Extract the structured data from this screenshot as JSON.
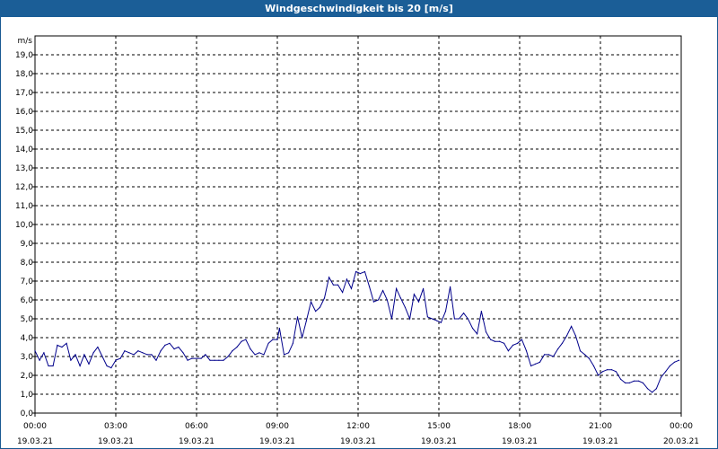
{
  "window": {
    "title": "Windgeschwindigkeit bis 20 [m/s]"
  },
  "colors": {
    "title_bar": "#1b5e97",
    "series": "#00008b",
    "grid": "#000000",
    "background": "#ffffff"
  },
  "chart_data": {
    "type": "line",
    "title": "Windgeschwindigkeit bis 20 [m/s]",
    "ylabel": "m/s",
    "xlabel": "",
    "ylim": [
      0,
      20
    ],
    "xlim": [
      0,
      24
    ],
    "grid": true,
    "grid_style": "dashed",
    "yticks": [
      {
        "value": 0,
        "label": "0,0"
      },
      {
        "value": 1,
        "label": "1,0"
      },
      {
        "value": 2,
        "label": "2,0"
      },
      {
        "value": 3,
        "label": "3,0"
      },
      {
        "value": 4,
        "label": "4,0"
      },
      {
        "value": 5,
        "label": "5,0"
      },
      {
        "value": 6,
        "label": "6,0"
      },
      {
        "value": 7,
        "label": "7,0"
      },
      {
        "value": 8,
        "label": "8,0"
      },
      {
        "value": 9,
        "label": "9,0"
      },
      {
        "value": 10,
        "label": "10,0"
      },
      {
        "value": 11,
        "label": "11,0"
      },
      {
        "value": 12,
        "label": "12,0"
      },
      {
        "value": 13,
        "label": "13,0"
      },
      {
        "value": 14,
        "label": "14,0"
      },
      {
        "value": 15,
        "label": "15,0"
      },
      {
        "value": 16,
        "label": "16,0"
      },
      {
        "value": 17,
        "label": "17,0"
      },
      {
        "value": 18,
        "label": "18,0"
      },
      {
        "value": 19,
        "label": "19,0"
      }
    ],
    "xticks": [
      {
        "value": 0,
        "time": "00:00",
        "date": "19.03.21"
      },
      {
        "value": 3,
        "time": "03:00",
        "date": "19.03.21"
      },
      {
        "value": 6,
        "time": "06:00",
        "date": "19.03.21"
      },
      {
        "value": 9,
        "time": "09:00",
        "date": "19.03.21"
      },
      {
        "value": 12,
        "time": "12:00",
        "date": "19.03.21"
      },
      {
        "value": 15,
        "time": "15:00",
        "date": "19.03.21"
      },
      {
        "value": 18,
        "time": "18:00",
        "date": "19.03.21"
      },
      {
        "value": 21,
        "time": "21:00",
        "date": "19.03.21"
      },
      {
        "value": 24,
        "time": "00:00",
        "date": "20.03.21"
      }
    ],
    "series": [
      {
        "points": [
          [
            0.0,
            3.3
          ],
          [
            0.17,
            2.8
          ],
          [
            0.33,
            3.2
          ],
          [
            0.5,
            2.5
          ],
          [
            0.67,
            2.5
          ],
          [
            0.83,
            3.6
          ],
          [
            1.0,
            3.5
          ],
          [
            1.17,
            3.7
          ],
          [
            1.33,
            2.8
          ],
          [
            1.5,
            3.1
          ],
          [
            1.67,
            2.5
          ],
          [
            1.83,
            3.1
          ],
          [
            2.0,
            2.6
          ],
          [
            2.17,
            3.2
          ],
          [
            2.33,
            3.5
          ],
          [
            2.5,
            3.0
          ],
          [
            2.67,
            2.5
          ],
          [
            2.83,
            2.4
          ],
          [
            3.0,
            2.8
          ],
          [
            3.17,
            2.9
          ],
          [
            3.33,
            3.3
          ],
          [
            3.5,
            3.2
          ],
          [
            3.67,
            3.1
          ],
          [
            3.83,
            3.3
          ],
          [
            4.0,
            3.2
          ],
          [
            4.17,
            3.1
          ],
          [
            4.33,
            3.1
          ],
          [
            4.5,
            2.8
          ],
          [
            4.67,
            3.3
          ],
          [
            4.83,
            3.6
          ],
          [
            5.0,
            3.7
          ],
          [
            5.17,
            3.4
          ],
          [
            5.33,
            3.5
          ],
          [
            5.5,
            3.2
          ],
          [
            5.67,
            2.8
          ],
          [
            5.83,
            2.9
          ],
          [
            6.0,
            2.9
          ],
          [
            6.17,
            2.9
          ],
          [
            6.33,
            3.1
          ],
          [
            6.5,
            2.8
          ],
          [
            6.67,
            2.8
          ],
          [
            6.83,
            2.8
          ],
          [
            7.0,
            2.8
          ],
          [
            7.17,
            3.0
          ],
          [
            7.33,
            3.3
          ],
          [
            7.5,
            3.5
          ],
          [
            7.67,
            3.8
          ],
          [
            7.83,
            3.9
          ],
          [
            8.0,
            3.4
          ],
          [
            8.17,
            3.1
          ],
          [
            8.33,
            3.2
          ],
          [
            8.5,
            3.1
          ],
          [
            8.67,
            3.7
          ],
          [
            8.83,
            3.9
          ],
          [
            9.0,
            3.9
          ],
          [
            9.08,
            4.5
          ],
          [
            9.25,
            3.1
          ],
          [
            9.42,
            3.2
          ],
          [
            9.58,
            3.7
          ],
          [
            9.75,
            5.1
          ],
          [
            9.92,
            4.0
          ],
          [
            10.08,
            4.9
          ],
          [
            10.25,
            5.9
          ],
          [
            10.42,
            5.4
          ],
          [
            10.58,
            5.6
          ],
          [
            10.75,
            6.1
          ],
          [
            10.92,
            7.2
          ],
          [
            11.08,
            6.8
          ],
          [
            11.25,
            6.8
          ],
          [
            11.42,
            6.4
          ],
          [
            11.58,
            7.1
          ],
          [
            11.75,
            6.6
          ],
          [
            11.92,
            7.5
          ],
          [
            12.08,
            7.4
          ],
          [
            12.25,
            7.5
          ],
          [
            12.42,
            6.7
          ],
          [
            12.58,
            5.9
          ],
          [
            12.75,
            6.0
          ],
          [
            12.92,
            6.5
          ],
          [
            13.08,
            6.0
          ],
          [
            13.25,
            5.0
          ],
          [
            13.42,
            6.6
          ],
          [
            13.58,
            6.1
          ],
          [
            13.75,
            5.6
          ],
          [
            13.92,
            5.0
          ],
          [
            14.08,
            6.3
          ],
          [
            14.25,
            5.9
          ],
          [
            14.42,
            6.6
          ],
          [
            14.58,
            5.1
          ],
          [
            14.75,
            5.0
          ],
          [
            14.92,
            4.9
          ],
          [
            15.08,
            4.8
          ],
          [
            15.25,
            5.4
          ],
          [
            15.42,
            6.7
          ],
          [
            15.58,
            5.0
          ],
          [
            15.75,
            5.0
          ],
          [
            15.92,
            5.3
          ],
          [
            16.08,
            5.0
          ],
          [
            16.25,
            4.5
          ],
          [
            16.42,
            4.2
          ],
          [
            16.58,
            5.4
          ],
          [
            16.75,
            4.3
          ],
          [
            16.92,
            3.9
          ],
          [
            17.08,
            3.8
          ],
          [
            17.25,
            3.8
          ],
          [
            17.42,
            3.7
          ],
          [
            17.58,
            3.3
          ],
          [
            17.75,
            3.6
          ],
          [
            17.92,
            3.7
          ],
          [
            18.08,
            3.9
          ],
          [
            18.25,
            3.3
          ],
          [
            18.42,
            2.5
          ],
          [
            18.58,
            2.6
          ],
          [
            18.75,
            2.7
          ],
          [
            18.92,
            3.1
          ],
          [
            19.08,
            3.1
          ],
          [
            19.25,
            3.0
          ],
          [
            19.42,
            3.4
          ],
          [
            19.58,
            3.7
          ],
          [
            19.75,
            4.1
          ],
          [
            19.92,
            4.6
          ],
          [
            20.08,
            4.1
          ],
          [
            20.25,
            3.3
          ],
          [
            20.42,
            3.1
          ],
          [
            20.58,
            2.9
          ],
          [
            20.75,
            2.5
          ],
          [
            20.92,
            2.0
          ],
          [
            21.08,
            2.2
          ],
          [
            21.25,
            2.3
          ],
          [
            21.42,
            2.3
          ],
          [
            21.58,
            2.2
          ],
          [
            21.75,
            1.8
          ],
          [
            21.92,
            1.6
          ],
          [
            22.08,
            1.6
          ],
          [
            22.25,
            1.7
          ],
          [
            22.42,
            1.7
          ],
          [
            22.58,
            1.6
          ],
          [
            22.75,
            1.3
          ],
          [
            22.92,
            1.1
          ],
          [
            23.08,
            1.3
          ],
          [
            23.25,
            1.9
          ],
          [
            23.42,
            2.2
          ],
          [
            23.58,
            2.5
          ],
          [
            23.75,
            2.7
          ],
          [
            23.92,
            2.8
          ]
        ]
      }
    ]
  }
}
